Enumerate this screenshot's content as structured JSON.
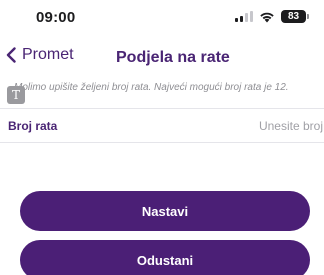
{
  "status_bar": {
    "time": "09:00",
    "battery": "83",
    "icons": [
      "signal-icon",
      "wifi-icon",
      "battery-icon"
    ]
  },
  "nav": {
    "back_label": "Promet",
    "title": "Podjela na rate"
  },
  "info": {
    "text": "Molimo upišite željeni broj rata. Najveći mogući broj rata je 12.",
    "badge": "T"
  },
  "form": {
    "field_label": "Broj rata",
    "field_value": "",
    "field_placeholder": "Unesite broj"
  },
  "actions": {
    "continue_label": "Nastavi",
    "cancel_label": "Odustani"
  },
  "colors": {
    "accent": "#4b1f76",
    "label": "#4a2574",
    "muted": "#8e8e93"
  }
}
